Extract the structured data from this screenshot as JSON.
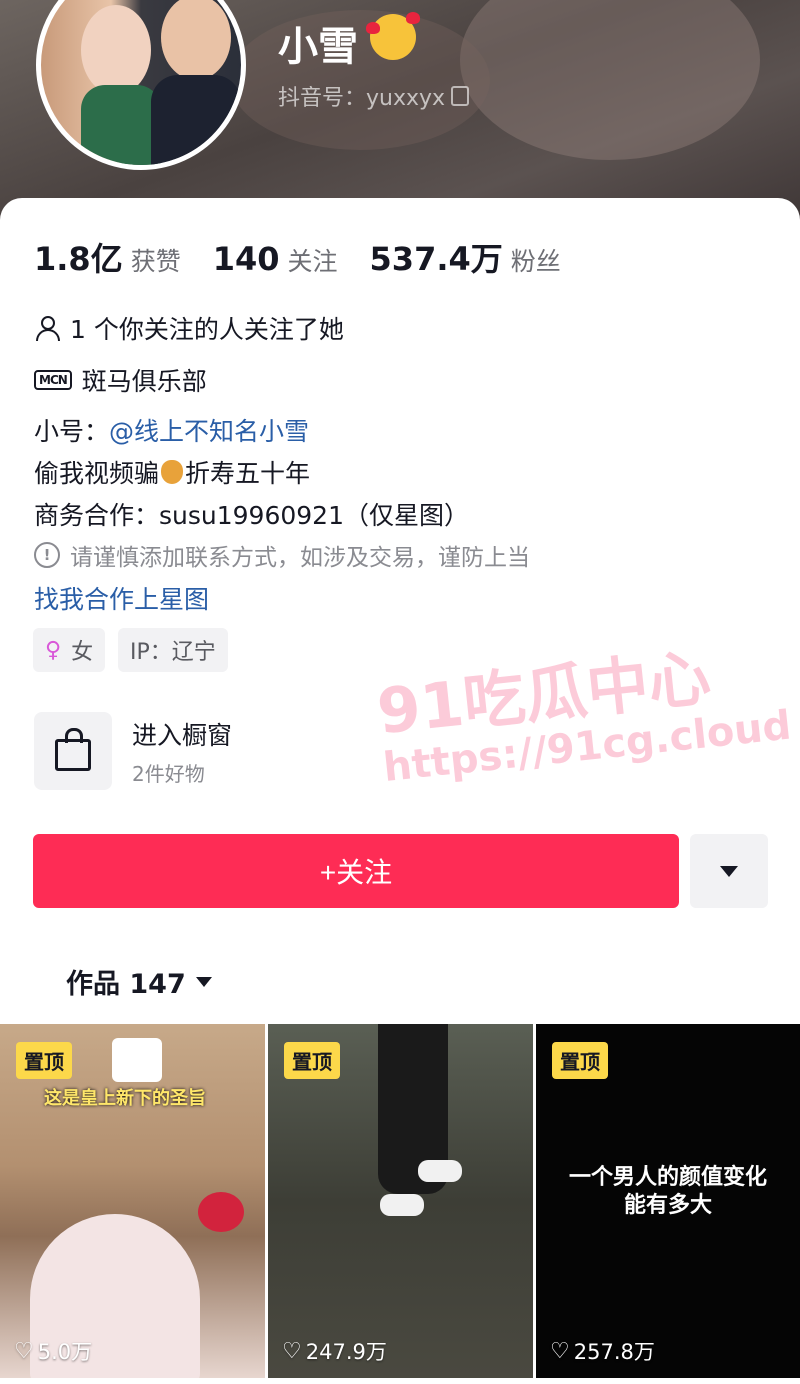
{
  "profile": {
    "name": "小雪",
    "douyin_id": "抖音号：yuxxyx"
  },
  "stats": [
    {
      "value": "1.8亿",
      "label": "获赞"
    },
    {
      "value": "140",
      "label": "关注"
    },
    {
      "value": "537.4万",
      "label": "粉丝"
    }
  ],
  "info": {
    "mutual": "1 个你关注的人关注了她",
    "mcn_badge": "MCN",
    "mcn": "斑马俱乐部",
    "alt_prefix": "小号：",
    "alt_link": "@线上不知名小雪",
    "bio_a": "偷我视频骗",
    "bio_b": "折寿五十年",
    "business": "商务合作：susu19960921（仅星图）",
    "warning": "请谨慎添加联系方式，如涉及交易，谨防上当",
    "star_link": "找我合作上星图"
  },
  "tags": {
    "gender": "女",
    "ip": "IP：辽宁"
  },
  "shop": {
    "title": "进入橱窗",
    "subtitle": "2件好物"
  },
  "actions": {
    "follow_label": "+关注"
  },
  "works": {
    "tab_label": "作品 147",
    "items": [
      {
        "pin": "置顶",
        "likes": "5.0万",
        "overlay": "这是皇上新下的圣旨"
      },
      {
        "pin": "置顶",
        "likes": "247.9万"
      },
      {
        "pin": "置顶",
        "likes": "257.8万",
        "overlay": "一个男人的颜值变化\n能有多大"
      }
    ]
  },
  "watermark": {
    "line1": "91吃瓜中心",
    "line2": "https://91cg.cloud"
  },
  "colors": {
    "follow_button": "#fe2c55",
    "link": "#2a5ea7",
    "pin_badge": "#fcd84a"
  }
}
